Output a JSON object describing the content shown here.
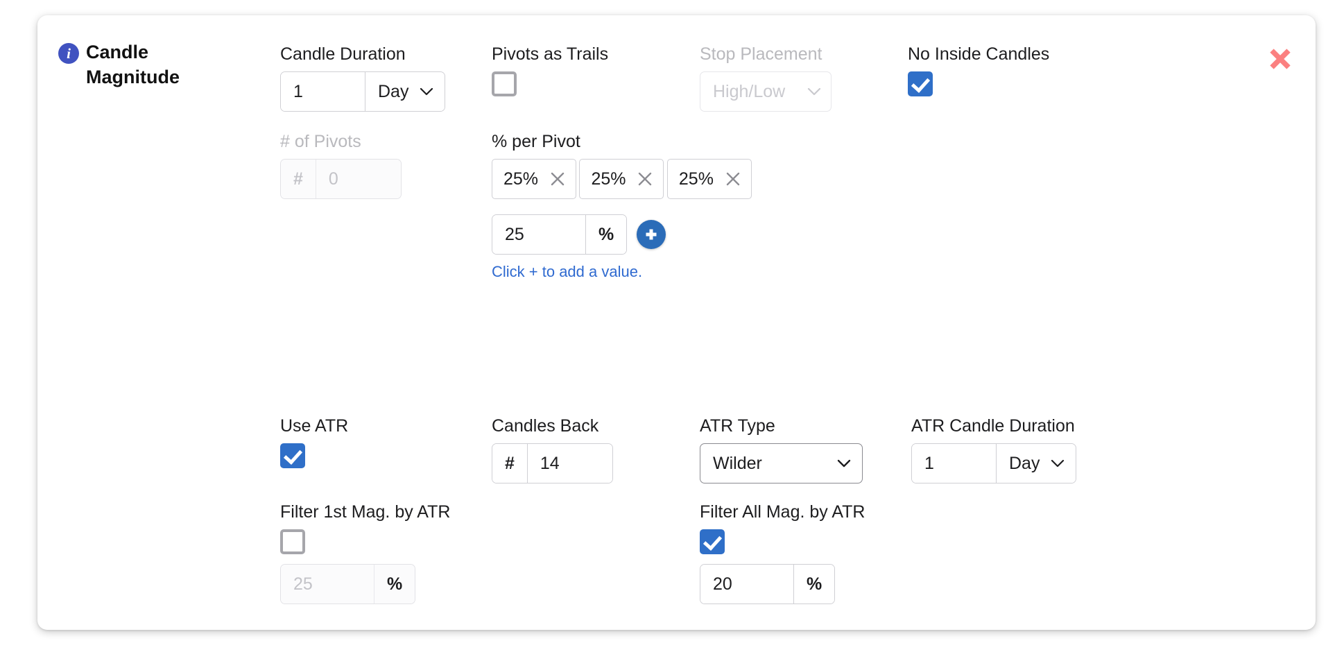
{
  "card": {
    "title": "Candle Magnitude",
    "info_icon": "info-icon",
    "close_icon": "close-icon",
    "accent_blue": "#2f6fc8",
    "info_purple": "#4052c0",
    "close_red": "#fb8080",
    "helper_blue": "#2f6ad0"
  },
  "candle_duration": {
    "label": "Candle Duration",
    "value": "1",
    "unit": "Day",
    "chevron": "chevron-down-icon"
  },
  "num_pivots": {
    "label": "# of Pivots",
    "addon": "#",
    "value": "0",
    "disabled": true
  },
  "pivots_as_trails": {
    "label": "Pivots as Trails",
    "checked": false
  },
  "percent_per_pivot": {
    "label": "% per Pivot",
    "chips": [
      {
        "value": "25%",
        "remove_icon": "close-icon"
      },
      {
        "value": "25%",
        "remove_icon": "close-icon"
      },
      {
        "value": "25%",
        "remove_icon": "close-icon"
      }
    ],
    "new_value": "25",
    "suffix": "%",
    "add_icon": "plus-icon",
    "helper": "Click + to add a value."
  },
  "stop_placement": {
    "label": "Stop Placement",
    "value": "High/Low",
    "disabled": true,
    "chevron": "chevron-down-icon"
  },
  "no_inside_candles": {
    "label": "No Inside Candles",
    "checked": true
  },
  "use_atr": {
    "label": "Use ATR",
    "checked": true
  },
  "candles_back": {
    "label": "Candles Back",
    "addon": "#",
    "value": "14"
  },
  "atr_type": {
    "label": "ATR Type",
    "value": "Wilder",
    "chevron": "chevron-down-icon"
  },
  "atr_candle_duration": {
    "label": "ATR Candle Duration",
    "value": "1",
    "unit": "Day",
    "chevron": "chevron-down-icon"
  },
  "filter_first_mag": {
    "label": "Filter 1st Mag. by ATR",
    "checked": false,
    "value": "25",
    "suffix": "%",
    "disabled": true
  },
  "filter_all_mag": {
    "label": "Filter All Mag. by ATR",
    "checked": true,
    "value": "20",
    "suffix": "%",
    "disabled": false
  }
}
